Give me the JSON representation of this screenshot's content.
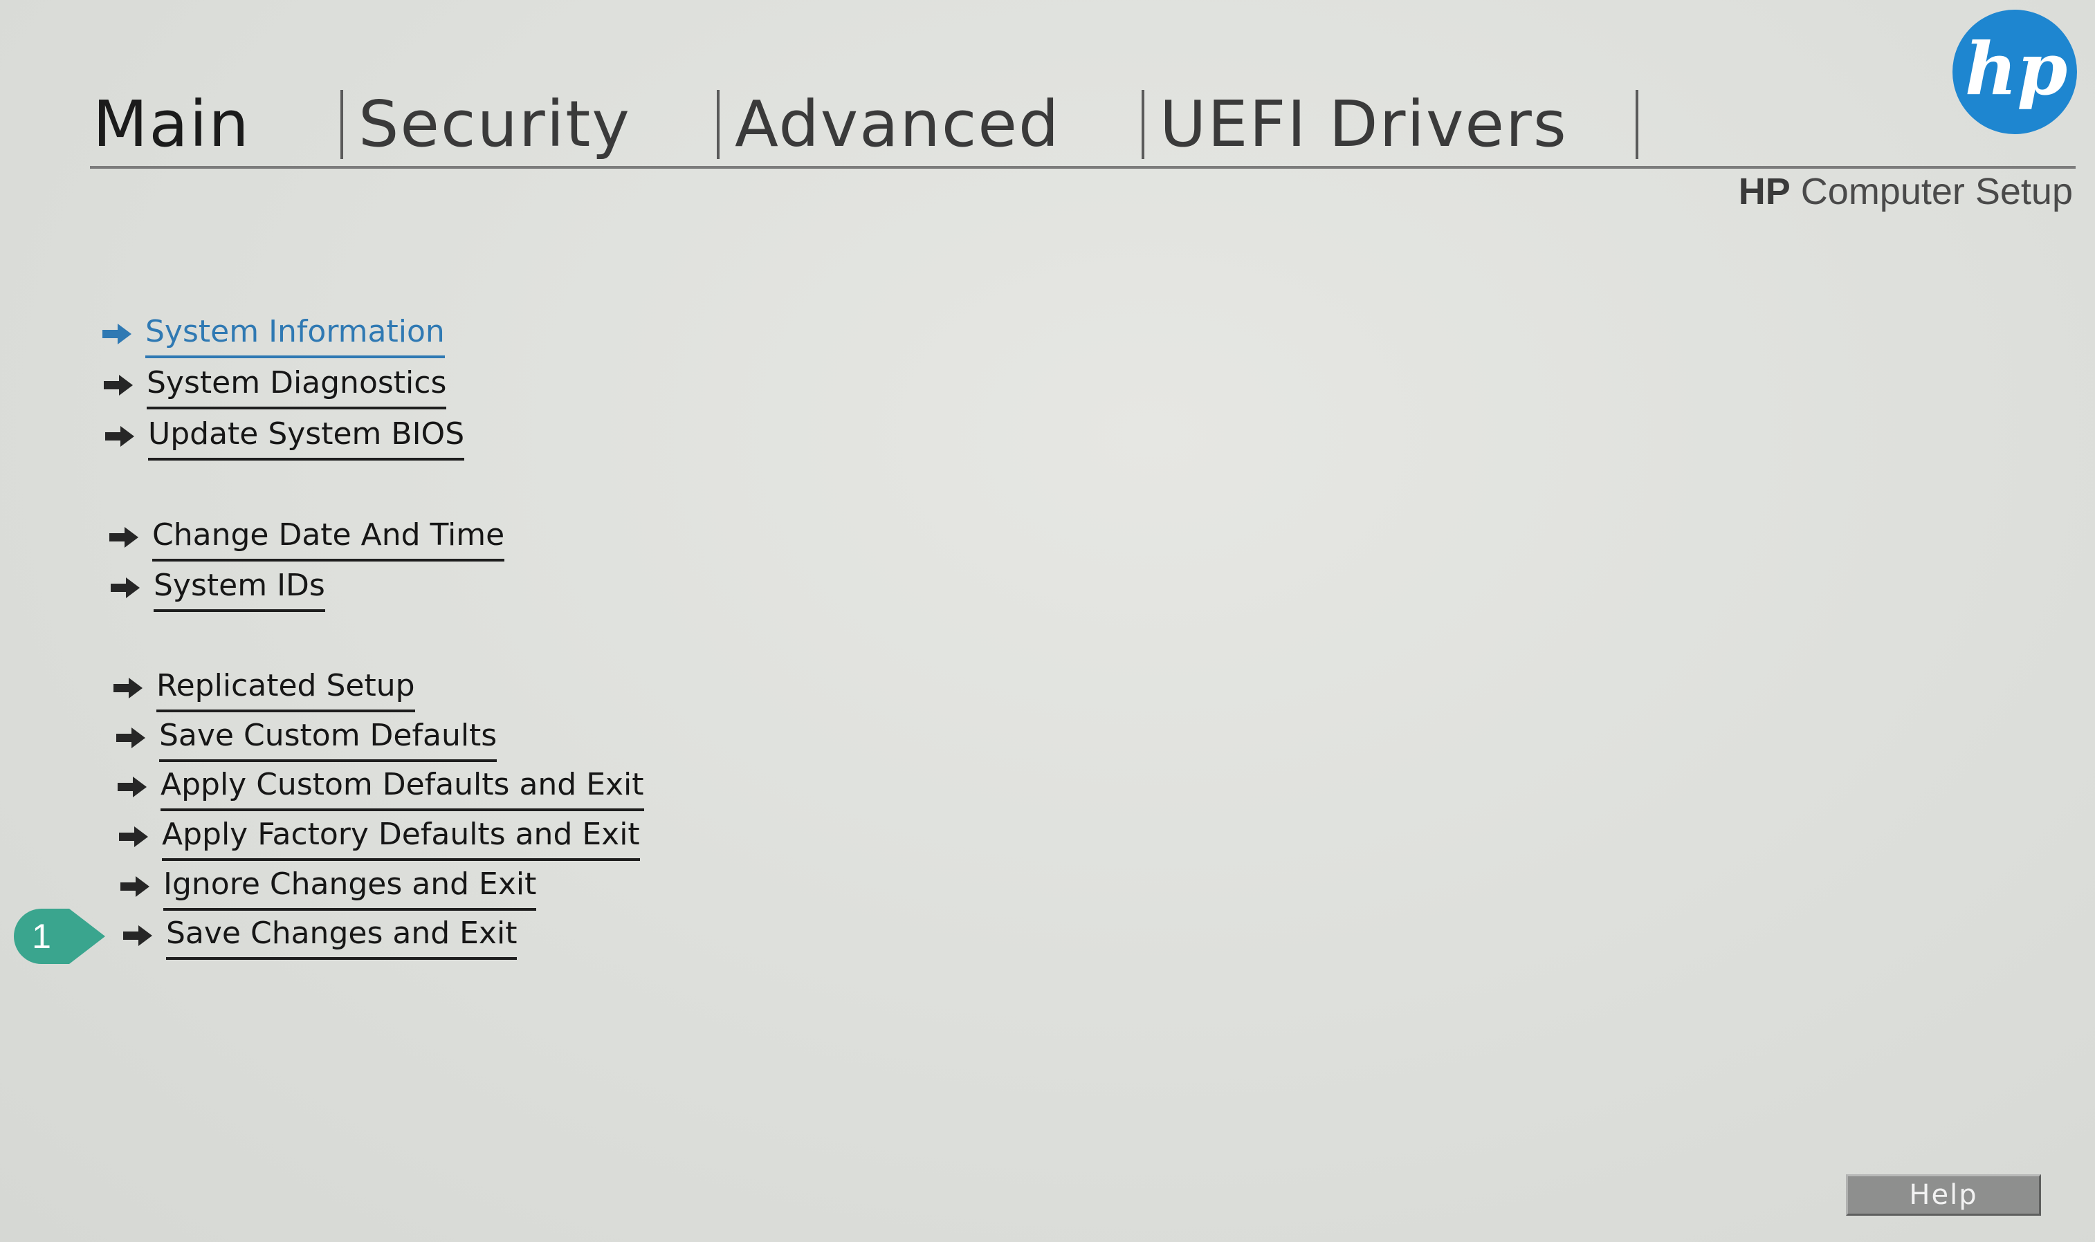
{
  "tabs": [
    {
      "label": "Main",
      "active": true
    },
    {
      "label": "Security",
      "active": false
    },
    {
      "label": "Advanced",
      "active": false
    },
    {
      "label": "UEFI Drivers",
      "active": false
    }
  ],
  "brand": {
    "logo_text": "hp",
    "title_bold": "HP",
    "title_rest": " Computer Setup"
  },
  "menu": {
    "selected_index": 0,
    "items": [
      {
        "label": "System Information"
      },
      {
        "label": "System Diagnostics"
      },
      {
        "label": "Update System BIOS"
      },
      {
        "label": "Change Date And Time"
      },
      {
        "label": "System IDs"
      },
      {
        "label": "Replicated Setup"
      },
      {
        "label": "Save Custom Defaults"
      },
      {
        "label": "Apply Custom Defaults and Exit"
      },
      {
        "label": "Apply Factory Defaults and Exit"
      },
      {
        "label": "Ignore Changes and Exit"
      },
      {
        "label": "Save Changes and Exit"
      }
    ]
  },
  "callout": {
    "number": "1",
    "target": "Save Changes and Exit"
  },
  "help": {
    "label": "Help"
  },
  "colors": {
    "accent": "#2f79b3",
    "logo_blue": "#1e86d0",
    "callout_teal": "#3aa58e",
    "text": "#161616",
    "background": "#e2e3df",
    "help_button": "#8e8f8e"
  },
  "icons": {
    "menu_arrow": "right-arrow-icon",
    "logo": "hp-logo-icon"
  }
}
